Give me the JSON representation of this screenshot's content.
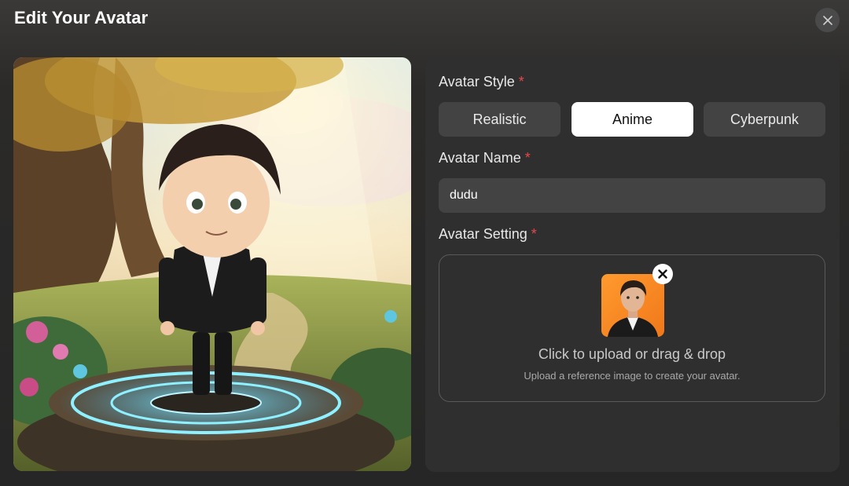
{
  "dialog": {
    "title": "Edit Your Avatar"
  },
  "icons": {
    "close": "close-icon",
    "remove": "close-icon"
  },
  "colors": {
    "accent_required": "#e5484d",
    "panel": "#2f2f2f",
    "button": "#434343",
    "active_button": "#ffffff"
  },
  "form": {
    "style": {
      "label": "Avatar Style",
      "required_mark": "*",
      "options": [
        "Realistic",
        "Anime",
        "Cyberpunk"
      ],
      "selected": "Anime"
    },
    "name": {
      "label": "Avatar Name",
      "required_mark": "*",
      "value": "dudu"
    },
    "setting": {
      "label": "Avatar Setting",
      "required_mark": "*",
      "upload_text": "Click to upload or drag & drop",
      "upload_hint": "Upload a reference image to create your avatar."
    }
  }
}
